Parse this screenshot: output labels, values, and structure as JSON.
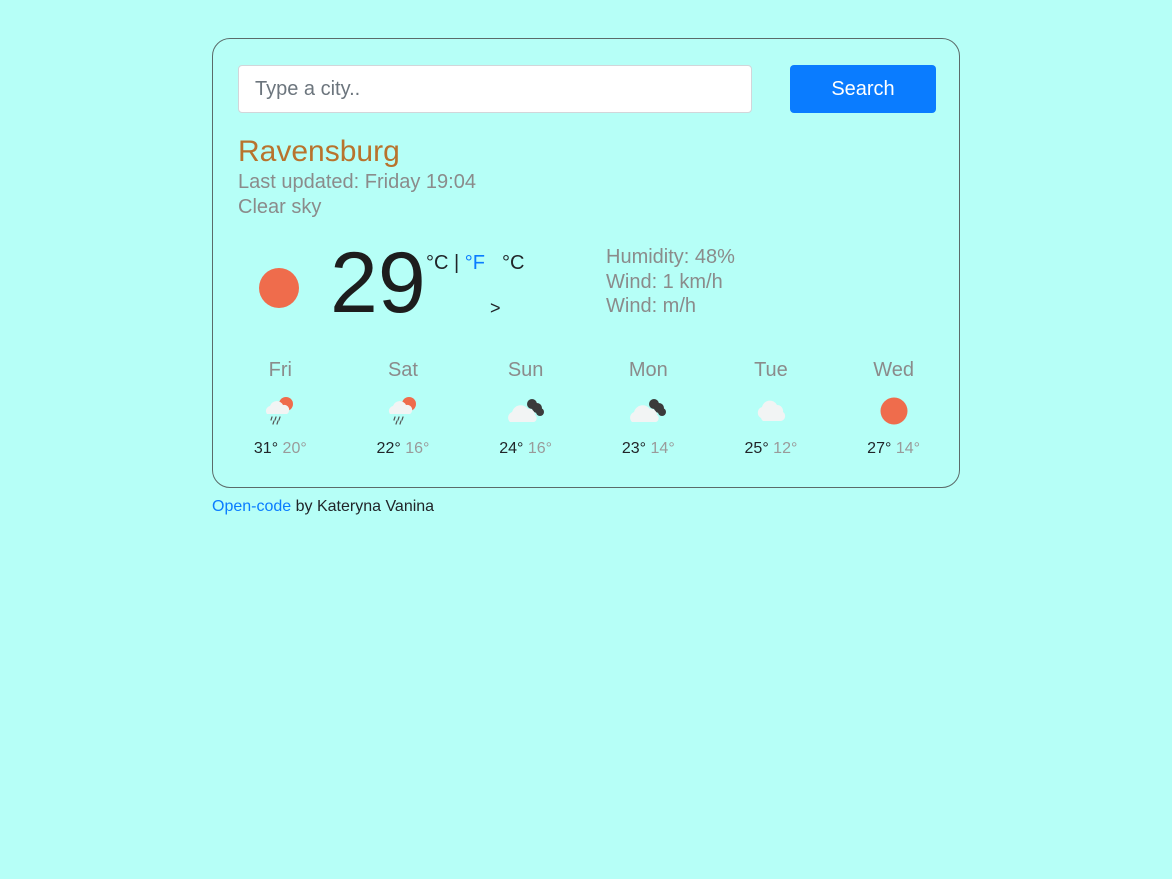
{
  "search": {
    "placeholder": "Type a city..",
    "value": "",
    "button_label": "Search"
  },
  "current": {
    "city": "Ravensburg",
    "last_updated": "Last updated: Friday 19:04",
    "description": "Clear sky",
    "icon": "sun-icon",
    "temperature": "29",
    "unit_c": "°C",
    "unit_sep": " | ",
    "unit_f": "°F",
    "unit_extra": "°C",
    "arrow": ">",
    "humidity": "Humidity: 48%",
    "wind": "Wind: 1 km/h",
    "wind2": "Wind: m/h"
  },
  "forecast": [
    {
      "day": "Fri",
      "icon": "rain-sun-icon",
      "max": "31°",
      "min": "20°"
    },
    {
      "day": "Sat",
      "icon": "rain-sun-icon",
      "max": "22°",
      "min": "16°"
    },
    {
      "day": "Sun",
      "icon": "broken-clouds-icon",
      "max": "24°",
      "min": "16°"
    },
    {
      "day": "Mon",
      "icon": "broken-clouds-icon",
      "max": "23°",
      "min": "14°"
    },
    {
      "day": "Tue",
      "icon": "cloud-icon",
      "max": "25°",
      "min": "12°"
    },
    {
      "day": "Wed",
      "icon": "sun-icon",
      "max": "27°",
      "min": "14°"
    }
  ],
  "footer": {
    "link_label": "Open-code",
    "by_text": " by Kateryna Vanina"
  },
  "colors": {
    "background": "#b6fff7",
    "accent": "#0a7cff",
    "city": "#b8732d",
    "sun": "#ef6c4c"
  }
}
